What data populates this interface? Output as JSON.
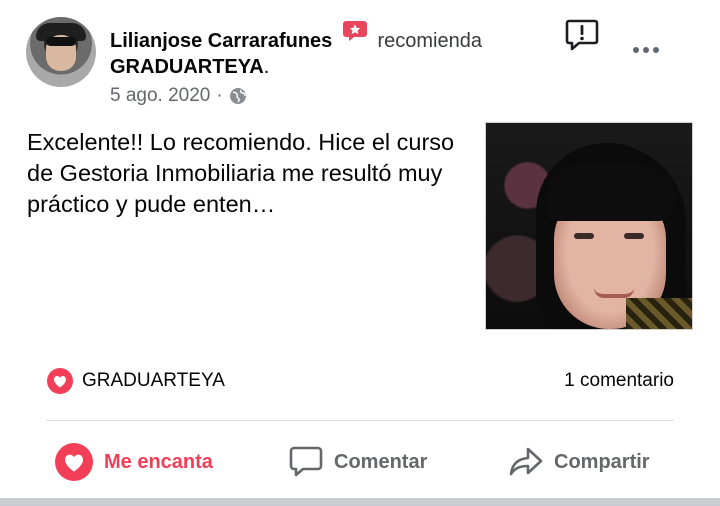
{
  "post": {
    "author": "Lilianjose Carrarafunes",
    "verb": "recomienda",
    "page_name": "GRADUARTEYA",
    "page_suffix": ".",
    "date": "5 ago. 2020",
    "separator": "·",
    "audience_icon": "globe-icon",
    "review_text": "Excelente!! Lo recomiendo. Hice el curso de Gestoria Inmobiliaria me resultó muy práctico y pude enten…"
  },
  "reactions": {
    "icon": "love-reaction-icon",
    "label": "GRADUARTEYA",
    "comments": "1 comentario"
  },
  "actions": {
    "love_label": "Me encanta",
    "comment_label": "Comentar",
    "share_label": "Compartir"
  },
  "colors": {
    "love_red": "#f33e58",
    "recommend_badge": "#e8465d",
    "secondary_text": "#65676b",
    "divider": "#dadde1"
  }
}
